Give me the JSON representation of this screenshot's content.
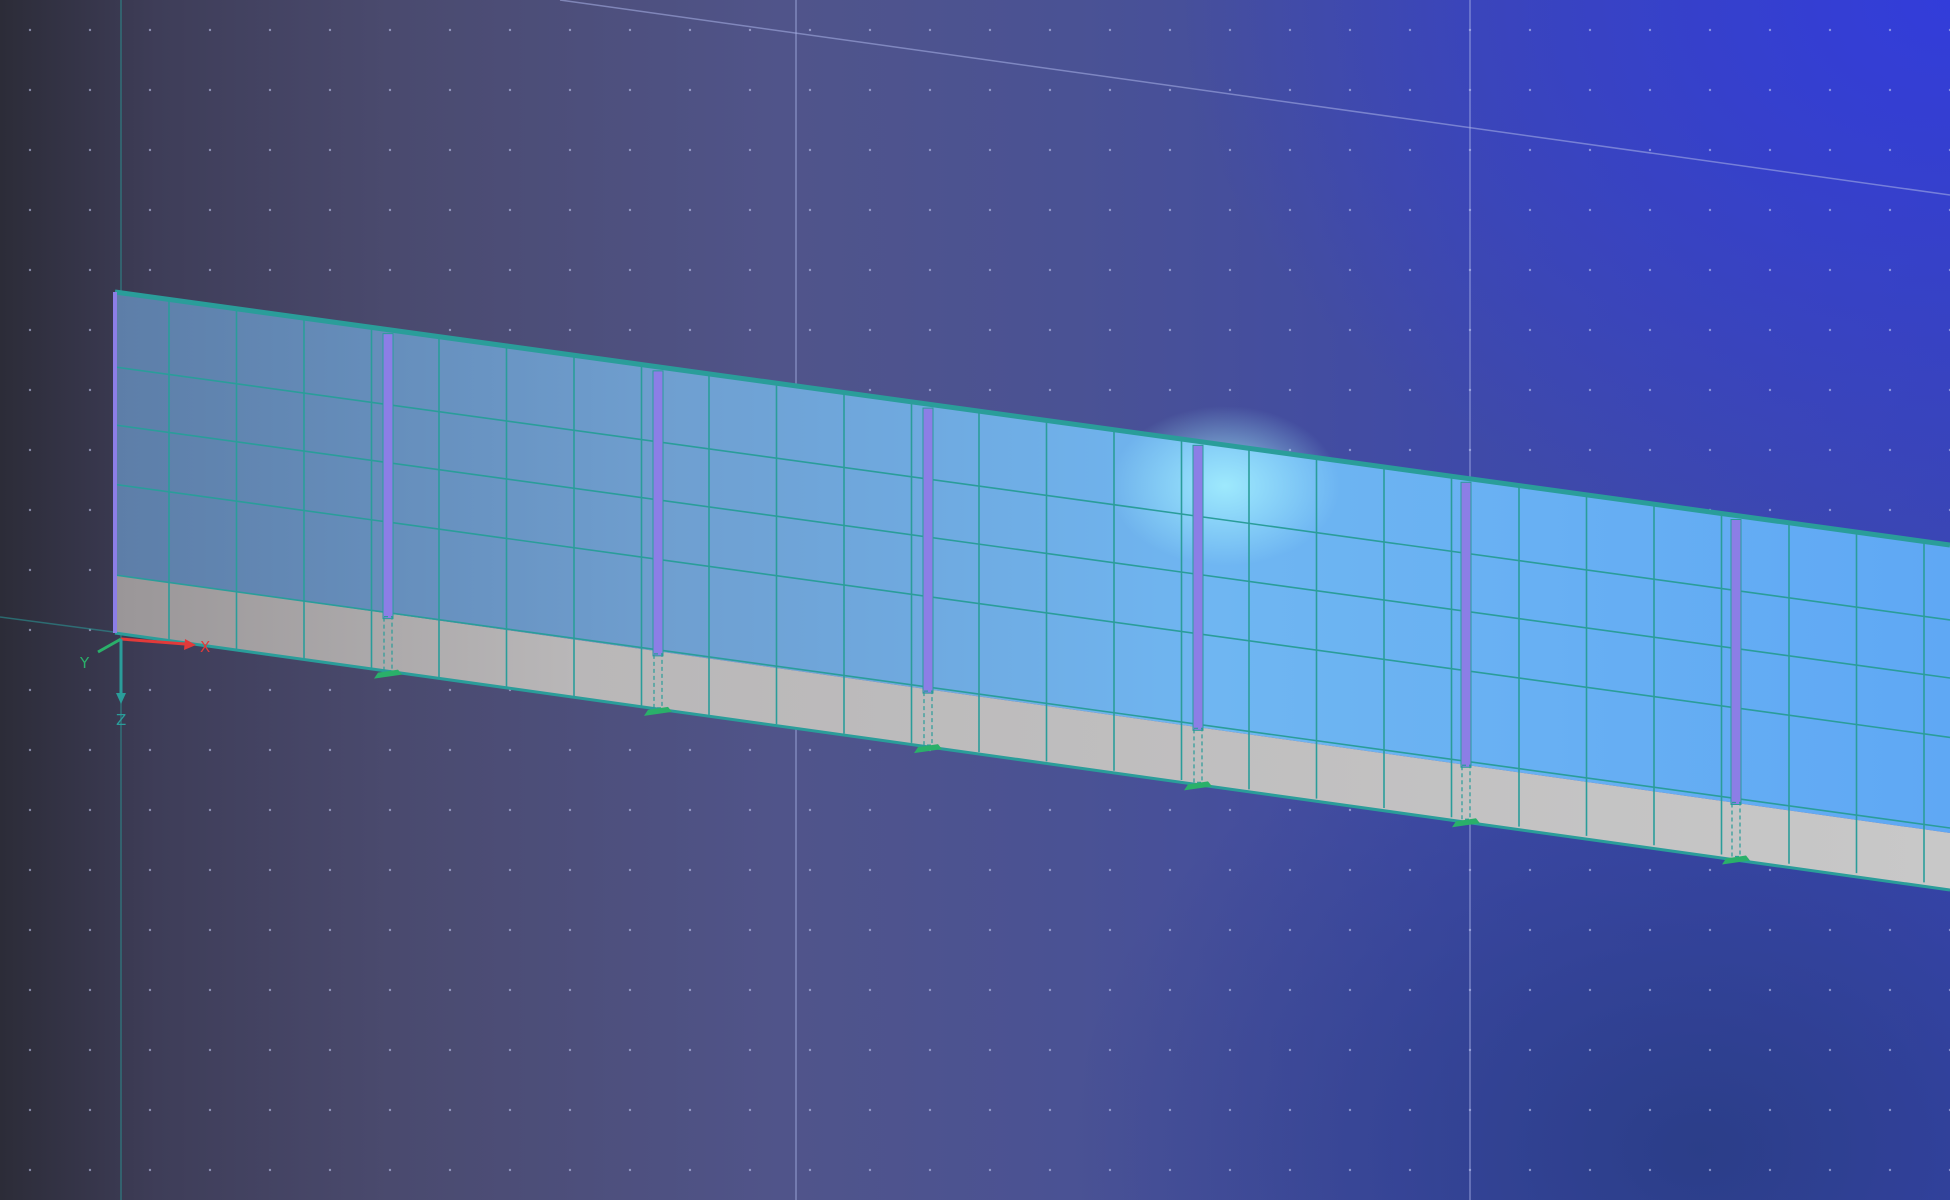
{
  "viewport": {
    "axis_labels": {
      "x": "X",
      "y": "Y",
      "z": "Z"
    },
    "colors": {
      "panel_fill": "#74b4ee",
      "panel_grid": "#2a9d9a",
      "plinth_fill": "#c6c6c6",
      "post_fill": "#8c7ee6",
      "support_fill": "#2ab06a",
      "axis_x": "#e23a3a",
      "axis_y": "#2ab06a",
      "axis_z": "#2a9d9a"
    },
    "icons": [
      "axis-triad-icon",
      "support-icon"
    ]
  }
}
